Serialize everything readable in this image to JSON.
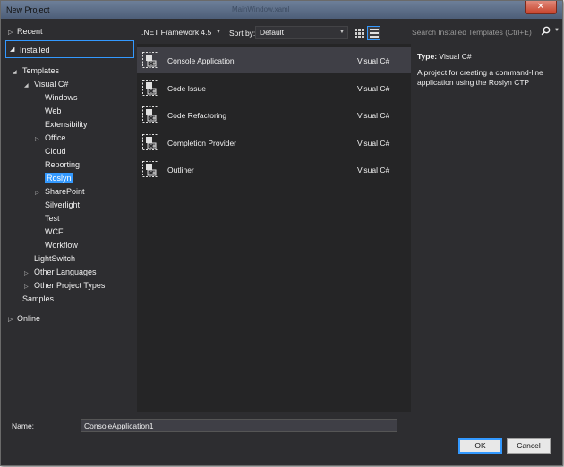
{
  "window": {
    "title": "New Project",
    "ghost_title": "MainWindow.xaml",
    "close_label": "✕"
  },
  "nav": {
    "recent": "Recent",
    "installed": "Installed",
    "online": "Online",
    "tree": [
      {
        "label": "Templates",
        "expander": "◢",
        "level": 0
      },
      {
        "label": "Visual C#",
        "expander": "◢",
        "level": 1
      },
      {
        "label": "Windows",
        "expander": "",
        "level": 2
      },
      {
        "label": "Web",
        "expander": "",
        "level": 2
      },
      {
        "label": "Extensibility",
        "expander": "",
        "level": 2
      },
      {
        "label": "Office",
        "expander": "▷",
        "level": 2
      },
      {
        "label": "Cloud",
        "expander": "",
        "level": 2
      },
      {
        "label": "Reporting",
        "expander": "",
        "level": 2
      },
      {
        "label": "Roslyn",
        "expander": "",
        "level": 2,
        "selected": true
      },
      {
        "label": "SharePoint",
        "expander": "▷",
        "level": 2
      },
      {
        "label": "Silverlight",
        "expander": "",
        "level": 2
      },
      {
        "label": "Test",
        "expander": "",
        "level": 2
      },
      {
        "label": "WCF",
        "expander": "",
        "level": 2
      },
      {
        "label": "Workflow",
        "expander": "",
        "level": 2
      },
      {
        "label": "LightSwitch",
        "expander": "",
        "level": 1
      },
      {
        "label": "Other Languages",
        "expander": "▷",
        "level": 1
      },
      {
        "label": "Other Project Types",
        "expander": "▷",
        "level": 1
      },
      {
        "label": "Samples",
        "expander": "",
        "level": 0
      }
    ]
  },
  "toolbar": {
    "framework": ".NET Framework 4.5",
    "sort_label": "Sort by:",
    "sort_value": "Default",
    "search_placeholder": "Search Installed Templates (Ctrl+E)"
  },
  "templates": [
    {
      "name": "Console Application",
      "lang": "Visual C#",
      "selected": true
    },
    {
      "name": "Code Issue",
      "lang": "Visual C#"
    },
    {
      "name": "Code Refactoring",
      "lang": "Visual C#"
    },
    {
      "name": "Completion Provider",
      "lang": "Visual C#"
    },
    {
      "name": "Outliner",
      "lang": "Visual C#"
    }
  ],
  "details": {
    "type_label": "Type:",
    "type_value": "Visual C#",
    "description": "A project for creating a command-line application using the Roslyn CTP"
  },
  "bottom": {
    "name_label": "Name:",
    "name_value": "ConsoleApplication1",
    "ok_label": "OK",
    "cancel_label": "Cancel"
  },
  "colors": {
    "accent": "#3399ff",
    "background": "#2d2d30",
    "list_background": "#252526",
    "selected_row": "#3f3f46"
  },
  "icons": {
    "template_icon": "csharp-project-template-icon",
    "search": "search-icon",
    "view_grid": "small-icons-view-icon",
    "view_list": "list-view-icon"
  }
}
